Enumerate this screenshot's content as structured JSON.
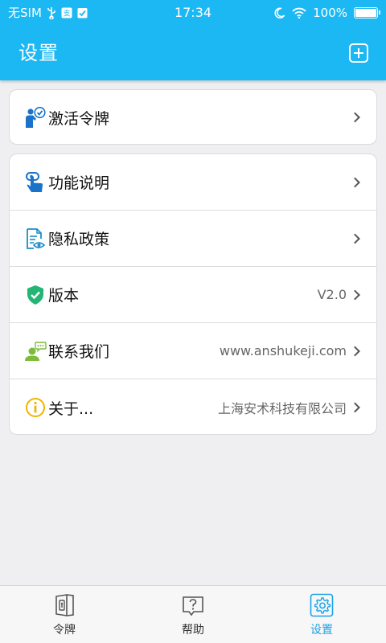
{
  "status_bar": {
    "carrier": "无SIM",
    "time": "17:34",
    "battery": "100%"
  },
  "header": {
    "title": "设置",
    "add_icon": "plus-square-icon"
  },
  "activate": {
    "label": "激活令牌",
    "icon": "user-chat-icon"
  },
  "settings": {
    "items": [
      {
        "label": "功能说明",
        "value": "",
        "icon": "touch-hand-icon"
      },
      {
        "label": "隐私政策",
        "value": "",
        "icon": "document-eye-icon"
      },
      {
        "label": "版本",
        "value": "V2.0",
        "icon": "shield-check-icon"
      },
      {
        "label": "联系我们",
        "value": "www.anshukeji.com",
        "icon": "contact-chat-icon"
      },
      {
        "label": "关于...",
        "value": "上海安术科技有限公司",
        "icon": "info-icon"
      }
    ]
  },
  "tabbar": {
    "tabs": [
      {
        "label": "令牌",
        "icon": "token-lock-icon",
        "active": false
      },
      {
        "label": "帮助",
        "icon": "help-question-icon",
        "active": false
      },
      {
        "label": "设置",
        "icon": "gear-icon",
        "active": true
      }
    ]
  },
  "colors": {
    "header_bg": "#1bb8f3",
    "accent": "#1aa3e8",
    "page_bg": "#efeff1"
  }
}
